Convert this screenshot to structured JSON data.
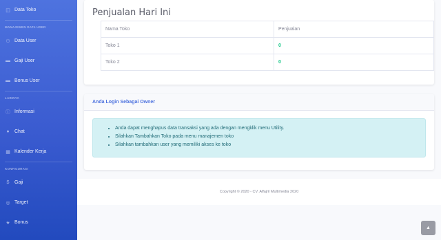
{
  "sidebar": {
    "top_item": {
      "label": "Data Toko",
      "icon": "store-icon"
    },
    "sections": [
      {
        "heading": "MANAJEMEN DATA USER",
        "items": [
          {
            "label": "Data User",
            "icon": "users-icon"
          },
          {
            "label": "Gaji User",
            "icon": "money-icon"
          },
          {
            "label": "Bonus User",
            "icon": "money-icon"
          }
        ]
      },
      {
        "heading": "LAINNYA",
        "items": [
          {
            "label": "Informasi",
            "icon": "info-icon"
          },
          {
            "label": "Chat",
            "icon": "chat-icon"
          },
          {
            "label": "Kalender Kerja",
            "icon": "calendar-icon"
          }
        ]
      },
      {
        "heading": "KONFIGURASI",
        "items": [
          {
            "label": "Gaji",
            "icon": "dollar-icon"
          },
          {
            "label": "Target",
            "icon": "target-icon"
          },
          {
            "label": "Bonus",
            "icon": "star-icon"
          }
        ]
      }
    ]
  },
  "sales": {
    "title": "Penjualan Hari Ini",
    "columns": [
      "Nama Toko",
      "Penjualan"
    ],
    "rows": [
      {
        "toko": "Toko 1",
        "penjualan": "0"
      },
      {
        "toko": "Toko 2",
        "penjualan": "0"
      }
    ]
  },
  "owner": {
    "header": "Anda Login Sebagai Owner",
    "notes": [
      "Anda dapat menghapus data transaksi yang ada dengan mengklik menu Utility.",
      "Silahkan Tambahkan Toko pada menu manajemen toko",
      "Silahkan tambahkan user yang memiliki akses ke toko"
    ]
  },
  "footer": {
    "copyright": "Copyright © 2020 - CV. Alfajril Multimedia 2020"
  },
  "colors": {
    "sidebar_top": "#4e73df",
    "sidebar_bottom": "#224abe",
    "accent": "#4e73df",
    "success": "#1cc88a",
    "info_bg": "#d4f1f4"
  }
}
